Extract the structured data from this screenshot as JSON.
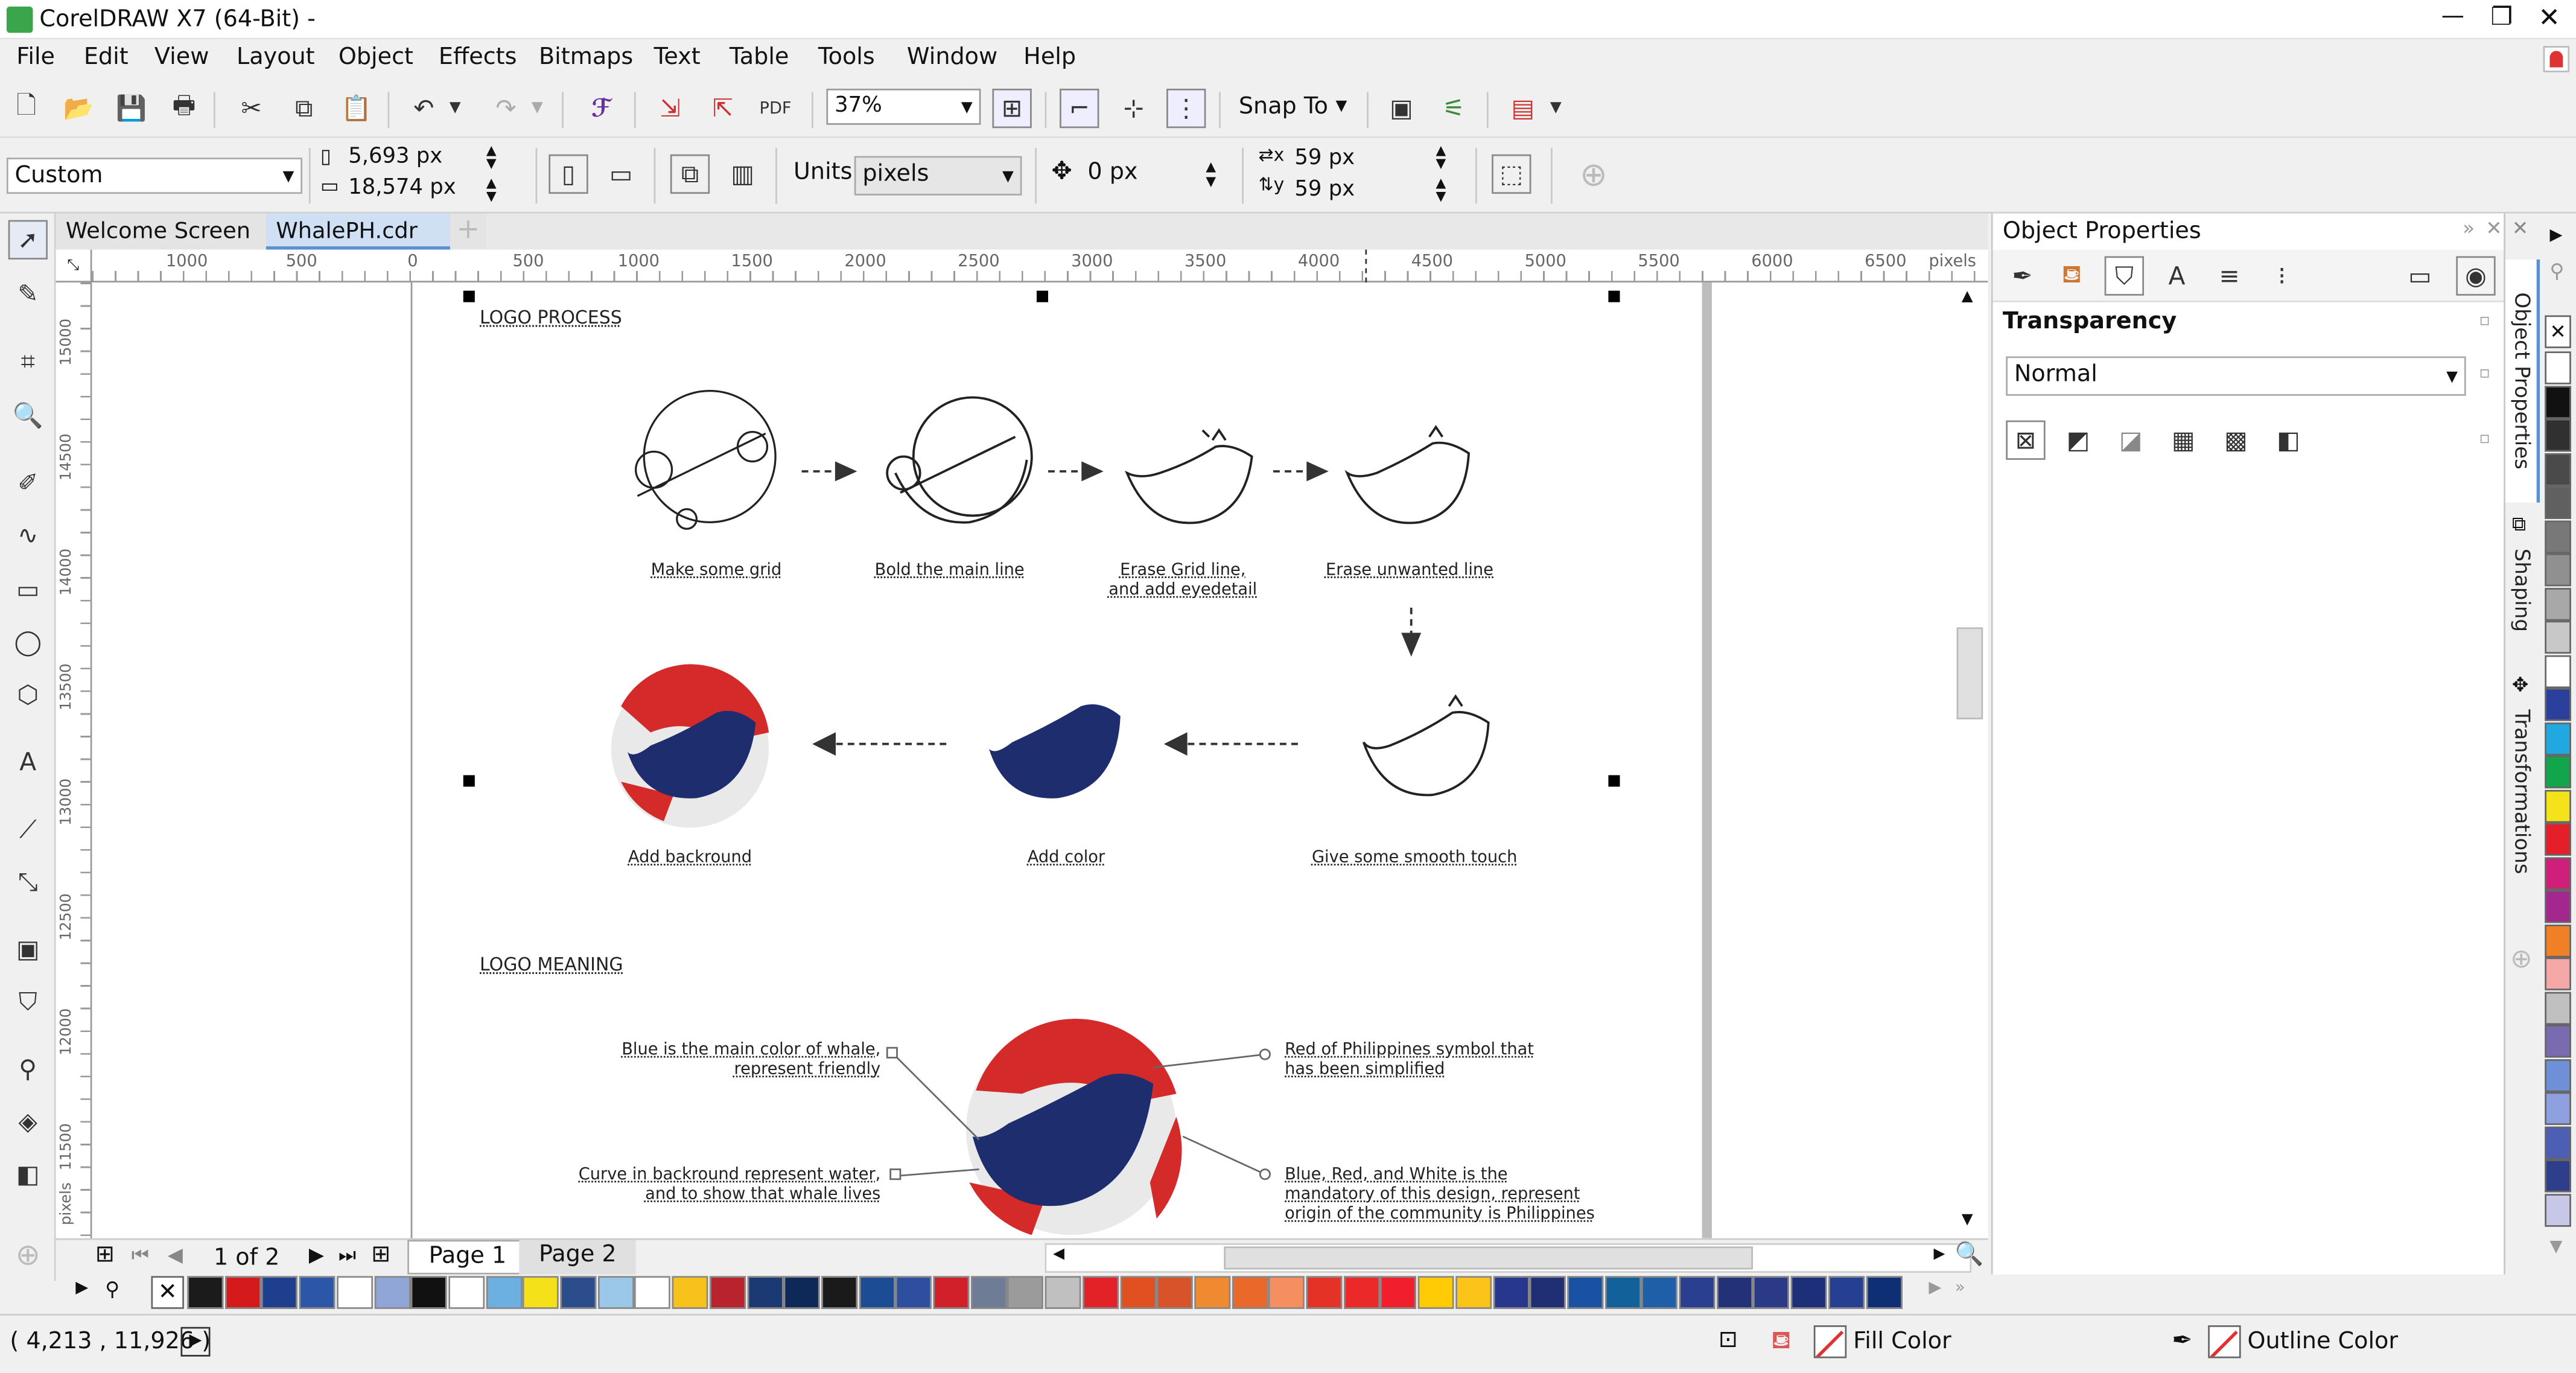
{
  "app": {
    "title": "CorelDRAW X7 (64-Bit) -"
  },
  "window_controls": {
    "minimize": "—",
    "restore": "❐",
    "close": "✕"
  },
  "menu": [
    "File",
    "Edit",
    "View",
    "Layout",
    "Object",
    "Effects",
    "Bitmaps",
    "Text",
    "Table",
    "Tools",
    "Window",
    "Help"
  ],
  "toolbar": {
    "zoom_value": "37%",
    "snap_label": "Snap To"
  },
  "property_bar": {
    "preset": "Custom",
    "width": "5,693 px",
    "height": "18,574 px",
    "units_label": "Units:",
    "units_value": "pixels",
    "nudge": "0 px",
    "dup_x": "59 px",
    "dup_y": "59 px"
  },
  "doc_tabs": [
    "Welcome Screen",
    "WhalePH.cdr"
  ],
  "rulers": {
    "h_ticks": [
      "1000",
      "500",
      "0",
      "500",
      "1000",
      "1500",
      "2000",
      "2500",
      "3000",
      "3500",
      "4000",
      "4500",
      "5000",
      "5500",
      "6000",
      "6500",
      "pixels"
    ],
    "v_ticks": [
      "15000",
      "14500",
      "14000",
      "13500",
      "13000",
      "12500",
      "12000",
      "11500"
    ],
    "v_unit": "pixels"
  },
  "canvas": {
    "section1_title": "LOGO PROCESS",
    "section2_title": "LOGO MEANING",
    "step_captions": [
      "Make some grid",
      "Bold the main line",
      "Erase  Grid line,\nand add eyedetail",
      "Erase unwanted line",
      "Give some smooth touch",
      "Add color",
      "Add backround"
    ],
    "meaning_notes": [
      "Blue is the main color of whale,\nrepresent friendly",
      "Curve in backround represent water,\nand to show that whale lives",
      "Red of Philippines symbol that\nhas been simplified",
      "Blue, Red, and White is the\nmandatory of this design, represent\norigin of the community is Philippines"
    ]
  },
  "pagination": {
    "page_count": "1 of 2",
    "pages": [
      "Page 1",
      "Page 2"
    ]
  },
  "status": {
    "coords": "( 4,213 , 11,926 )",
    "fill_label": "Fill Color",
    "outline_label": "Outline Color"
  },
  "docker": {
    "title": "Object Properties",
    "section": "Transparency",
    "merge_mode": "Normal"
  },
  "docker_tabs": [
    "Object Properties",
    "Shaping",
    "Transformations"
  ],
  "colors": {
    "brand_red": "#d42a2a",
    "brand_blue": "#1e2d6e",
    "palette": [
      "#1b1b1b",
      "#d41a1a",
      "#1e3f8e",
      "#2c57a8",
      "#ffffff",
      "#8fa6d6",
      "#111111",
      "#ffffff",
      "#6bb0e0",
      "#f5e11a",
      "#2b4d8c",
      "#9bc7e8",
      "#ffffff",
      "#f7c21b",
      "#b8232e",
      "#1b3a73",
      "#0e2858",
      "#1a1a1a",
      "#1c4c94",
      "#2e4fa0",
      "#d1202a",
      "#6f7c96",
      "#9b9b9b",
      "#c0c0c0",
      "#e32228",
      "#e05020",
      "#d8522a",
      "#f08a30",
      "#e9682a",
      "#f58f60",
      "#e53227",
      "#eb2929",
      "#f11f2d",
      "#ffcb05",
      "#fbc419",
      "#27378e",
      "#202e73",
      "#1a52a3",
      "#12619a",
      "#1e5fa8",
      "#2b3f91",
      "#233278",
      "#2a3a86",
      "#1e2f7a",
      "#253f93",
      "#0e2f73"
    ],
    "right_palette": [
      "#ffffff",
      "#111111",
      "#303030",
      "#4a4a4a",
      "#606060",
      "#787878",
      "#909090",
      "#a8a8a8",
      "#c8c8c8",
      "#ffffff",
      "#2b3f9c",
      "#21a8e0",
      "#13a54b",
      "#f4e21b",
      "#e51f2a",
      "#cf1f7a",
      "#a4268f",
      "#f07f26",
      "#f4a8a8",
      "#c0c0c0",
      "#7a6bb0",
      "#6f8fd6",
      "#8fa0e0",
      "#4d5fb5",
      "#2e3e8a",
      "#c7c7e8"
    ]
  },
  "icons": [
    "new-icon",
    "open-icon",
    "save-icon",
    "print-icon",
    "cut-icon",
    "copy-icon",
    "paste-icon",
    "undo-icon",
    "redo-icon",
    "corel-connect-icon",
    "import-icon",
    "export-icon",
    "publish-pdf-icon",
    "full-screen-icon",
    "show-rulers-icon",
    "show-grid-icon",
    "show-guidelines-icon",
    "options-icon",
    "app-launcher-icon",
    "welcome-icon",
    "pick-tool-icon",
    "shape-tool-icon",
    "crop-tool-icon",
    "zoom-tool-icon",
    "freehand-tool-icon",
    "artistic-media-icon",
    "rectangle-tool-icon",
    "ellipse-tool-icon",
    "polygon-tool-icon",
    "text-tool-icon",
    "parallel-dimension-icon",
    "connector-tool-icon",
    "drop-shadow-icon",
    "transparency-tool-icon",
    "color-eyedropper-icon",
    "interactive-fill-icon",
    "smart-fill-icon"
  ]
}
